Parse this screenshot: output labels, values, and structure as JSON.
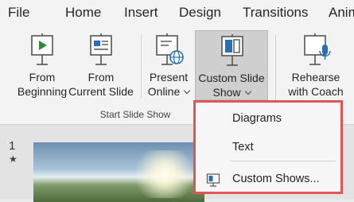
{
  "menubar": {
    "tabs": [
      "File",
      "Home",
      "Insert",
      "Design",
      "Transitions",
      "Anim"
    ]
  },
  "ribbon": {
    "from_beginning": {
      "line1": "From",
      "line2": "Beginning"
    },
    "from_current": {
      "line1": "From",
      "line2": "Current Slide"
    },
    "present_online": {
      "line1": "Present",
      "line2": "Online"
    },
    "custom_slide_show": {
      "line1": "Custom Slide",
      "line2": "Show"
    },
    "rehearse": {
      "line1": "Rehearse",
      "line2": "with Coach"
    },
    "group_label": "Start Slide Show"
  },
  "slides": {
    "number": "1",
    "star": "★"
  },
  "dropdown": {
    "items": [
      "Diagrams",
      "Text",
      "Custom Shows..."
    ],
    "highlight_color": "#e25555"
  },
  "colors": {
    "icon_green": "#2e8b3c",
    "icon_blue": "#2a6fb5",
    "accent_red": "#e25555"
  }
}
